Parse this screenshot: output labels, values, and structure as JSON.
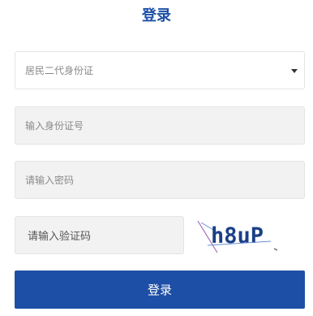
{
  "form": {
    "title": "登录",
    "id_type_select": {
      "selected": "居民二代身份证"
    },
    "id_number_input": {
      "placeholder": "输入身份证号"
    },
    "password_input": {
      "placeholder": "请输入密码"
    },
    "captcha_input": {
      "placeholder": "请输入验证码"
    },
    "captcha_image": {
      "text": "h8uP"
    },
    "submit_label": "登录"
  },
  "colors": {
    "primary": "#1e4fa6",
    "input_background": "#f2f2f2",
    "border": "#e4e4e4"
  }
}
